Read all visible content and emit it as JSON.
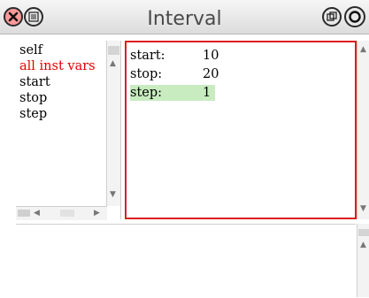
{
  "window": {
    "title": "Interval"
  },
  "fields": {
    "items": [
      "self",
      "all inst vars",
      "start",
      "stop",
      "step"
    ],
    "selected_index": 1
  },
  "values": {
    "rows": [
      {
        "key": "start:",
        "value": "10"
      },
      {
        "key": "stop:",
        "value": "20"
      },
      {
        "key": "step:",
        "value": "1"
      }
    ],
    "highlighted_row": 2
  },
  "icons": {
    "close": "close-icon",
    "menu": "window-menu-icon",
    "collapse": "collapse-icon",
    "expand": "expand-icon"
  },
  "colors": {
    "selected_text": "#e30000",
    "focus_border": "#e21d1d",
    "highlight": "#c8ecc0"
  }
}
